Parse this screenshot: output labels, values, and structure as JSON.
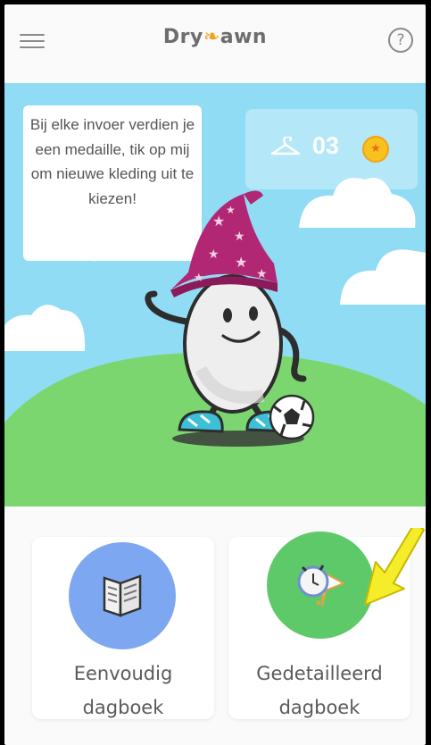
{
  "header": {
    "logo_left": "Dry",
    "logo_right": "awn",
    "help_icon": "question-circle-icon",
    "help_glyph": "?",
    "menu_icon": "hamburger-menu-icon"
  },
  "scene": {
    "speech_text": "Bij elke invoer verdien je een medaille, tik op mij om nieuwe kleding uit te kiezen!",
    "medal_count": "03",
    "medal_icon": "star-medal-icon",
    "hanger_icon": "hanger-icon"
  },
  "cards": [
    {
      "label_line1": "Eenvoudig",
      "label_line2": "dagboek",
      "icon": "open-book-icon",
      "color": "#7ea7f1"
    },
    {
      "label_line1": "Gedetailleerd",
      "label_line2": "dagboek",
      "icon": "alarm-clock-icon",
      "color": "#5ec969"
    }
  ],
  "colors": {
    "sky": "#91dcf5",
    "grass": "#7bd66f",
    "accent": "#f3a11f",
    "arrow": "#f5ec2a"
  }
}
